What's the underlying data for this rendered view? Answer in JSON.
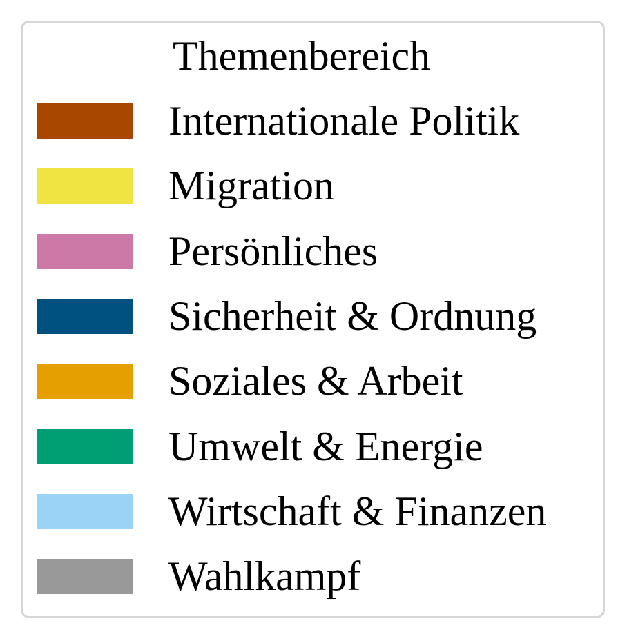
{
  "chart_data": {
    "type": "legend",
    "legend": {
      "title": "Themenbereich",
      "entries": [
        {
          "label": "Internationale Politik",
          "color": "#a84800"
        },
        {
          "label": "Migration",
          "color": "#f0e442"
        },
        {
          "label": "Persönliches",
          "color": "#cc79a7"
        },
        {
          "label": "Sicherheit & Ordnung",
          "color": "#005080"
        },
        {
          "label": "Soziales & Arbeit",
          "color": "#e69f00"
        },
        {
          "label": "Umwelt & Energie",
          "color": "#009e73"
        },
        {
          "label": "Wirtschaft & Finanzen",
          "color": "#99d3f5"
        },
        {
          "label": "Wahlkampf",
          "color": "#999999"
        }
      ]
    }
  }
}
